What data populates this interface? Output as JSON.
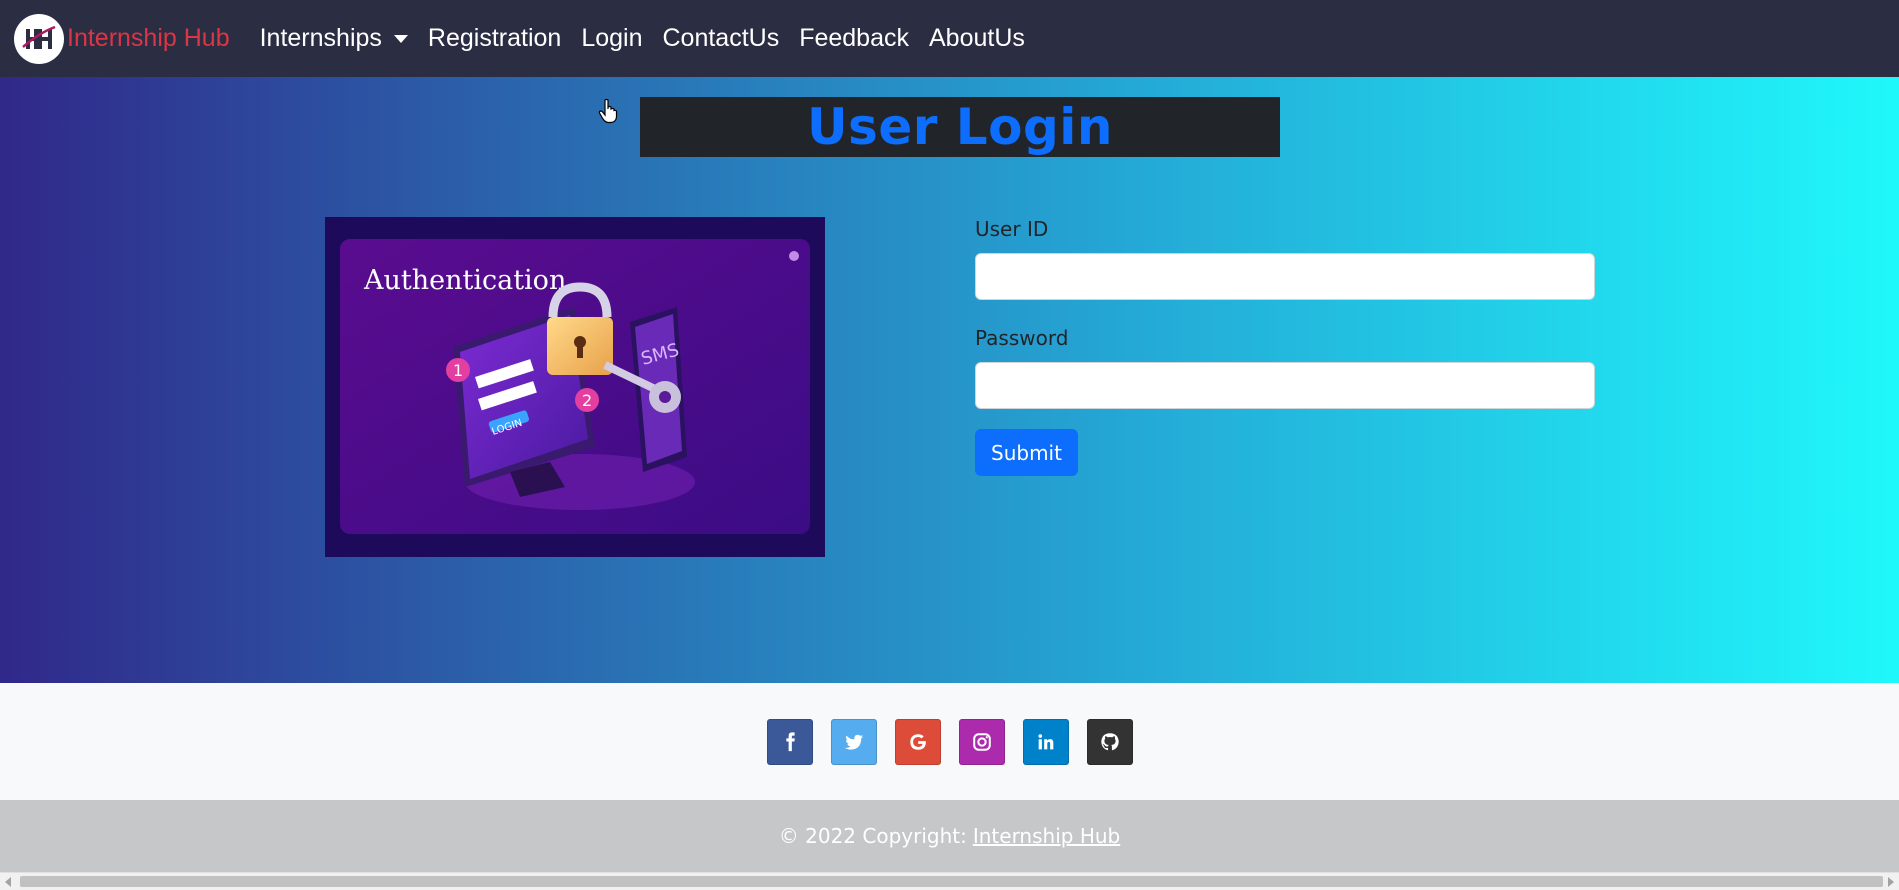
{
  "navbar": {
    "brand": "Internship Hub",
    "links": [
      {
        "label": "Internships",
        "dropdown": true
      },
      {
        "label": "Registration"
      },
      {
        "label": "Login"
      },
      {
        "label": "ContactUs"
      },
      {
        "label": "Feedback"
      },
      {
        "label": "AboutUs"
      }
    ]
  },
  "main": {
    "title": "User Login",
    "image": {
      "caption": "Authentication",
      "screen_text": "LOGIN",
      "phone_text": "SMS",
      "step_1": "1",
      "step_2": "2"
    },
    "form": {
      "user_id_label": "User ID",
      "user_id_value": "",
      "password_label": "Password",
      "password_value": "",
      "submit_label": "Submit"
    }
  },
  "social": [
    {
      "icon": "facebook-icon",
      "glyph": "f",
      "color": "#3b5998"
    },
    {
      "icon": "twitter-icon",
      "glyph": "",
      "color": "#55acee"
    },
    {
      "icon": "google-icon",
      "glyph": "G",
      "color": "#dd4b39"
    },
    {
      "icon": "instagram-icon",
      "glyph": "",
      "color": "#ac2bac"
    },
    {
      "icon": "linkedin-icon",
      "glyph": "in",
      "color": "#0082ca"
    },
    {
      "icon": "github-icon",
      "glyph": "",
      "color": "#333333"
    }
  ],
  "footer": {
    "copyright_prefix": "© 2022 Copyright:",
    "copyright_link": "Internship Hub"
  },
  "colors": {
    "navbar_bg": "#2b2d42",
    "brand_red": "#dc3545",
    "primary_blue": "#0d6efd",
    "title_box_bg": "#212529",
    "footer_bg": "#c6c7c9"
  }
}
